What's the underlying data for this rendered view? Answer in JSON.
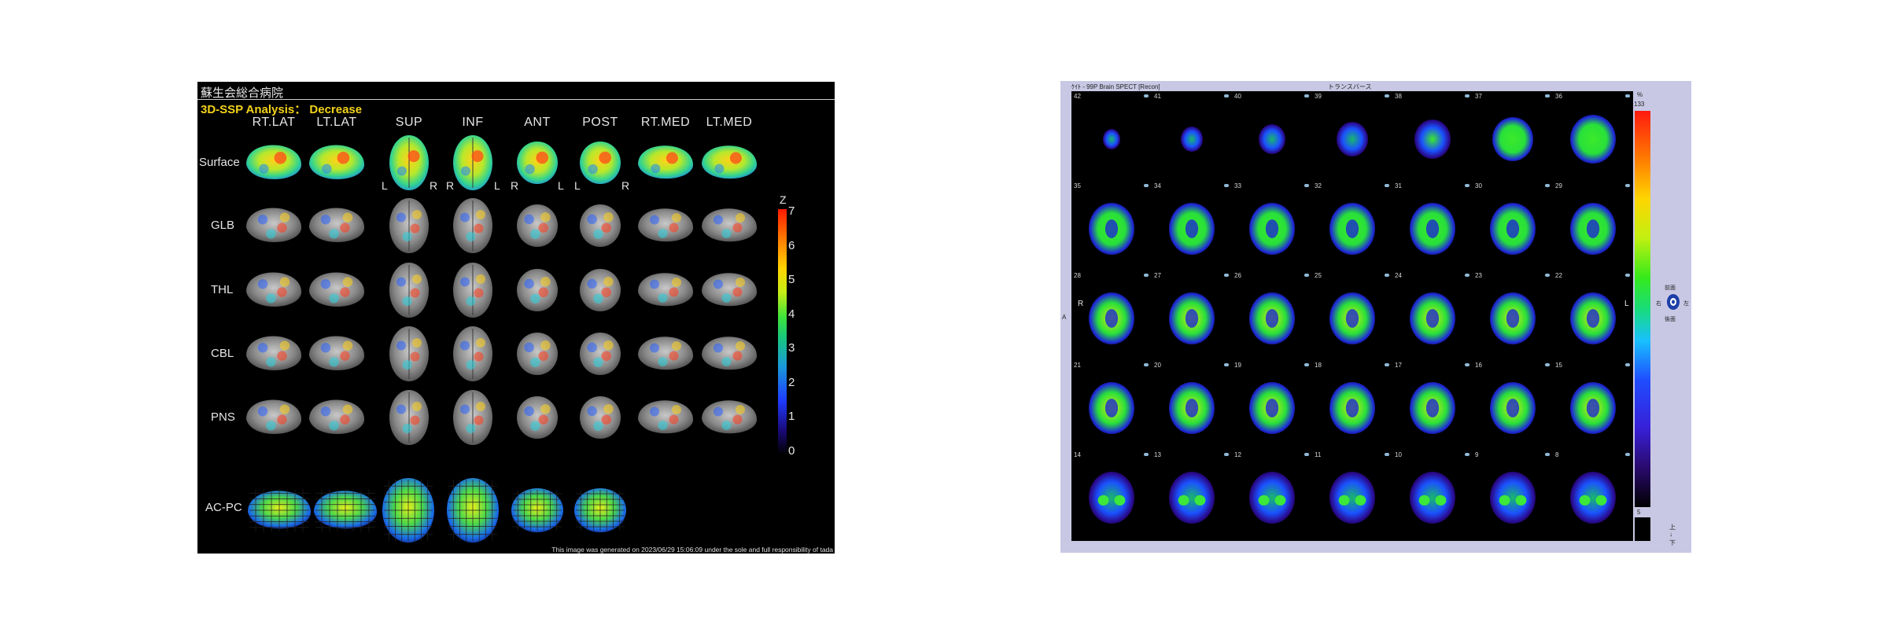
{
  "left": {
    "hospital": "蘇生会総合病院",
    "analysis_title": "3D-SSP Analysis： Decrease",
    "columns": [
      "RT.LAT",
      "LT.LAT",
      "SUP",
      "INF",
      "ANT",
      "POST",
      "RT.MED",
      "LT.MED"
    ],
    "rows": [
      "Surface",
      "GLB",
      "THL",
      "CBL",
      "PNS"
    ],
    "acpc_label": "AC-PC",
    "orientation": {
      "sup_l": "L",
      "sup_r": "R",
      "inf_r": "R",
      "inf_l": "L",
      "ant_r": "R",
      "ant_l": "L",
      "post_l": "L",
      "post_r": "R"
    },
    "colorbar": {
      "title": "Z",
      "ticks": [
        "7",
        "6",
        "5",
        "4",
        "3",
        "2",
        "1",
        "0"
      ],
      "high_color": "#ff1a00",
      "low_color": "#000000"
    },
    "footer": "This image was generated on 2023/06/29 15:06:09 under the sole and full responsibility of tada"
  },
  "right": {
    "header_left": "ｹｲﾄ - 99P Brain SPECT [Recon]",
    "header_mid": "トランスバース",
    "slices": [
      [
        "42",
        "41",
        "40",
        "39",
        "38",
        "37",
        "36"
      ],
      [
        "35",
        "34",
        "33",
        "32",
        "31",
        "30",
        "29"
      ],
      [
        "28",
        "27",
        "26",
        "25",
        "24",
        "23",
        "22"
      ],
      [
        "21",
        "20",
        "19",
        "18",
        "17",
        "16",
        "15"
      ],
      [
        "14",
        "13",
        "12",
        "11",
        "10",
        "9",
        "8"
      ]
    ],
    "side_left": "R",
    "side_right": "L",
    "anterior_mark": "A",
    "colorbar": {
      "unit": "%",
      "max": "133",
      "min": "5"
    },
    "orientation_labels": {
      "top": "前面",
      "left": "右",
      "right": "左",
      "bottom": "後面"
    },
    "axis_labels": {
      "up": "上",
      "down": "下"
    }
  }
}
